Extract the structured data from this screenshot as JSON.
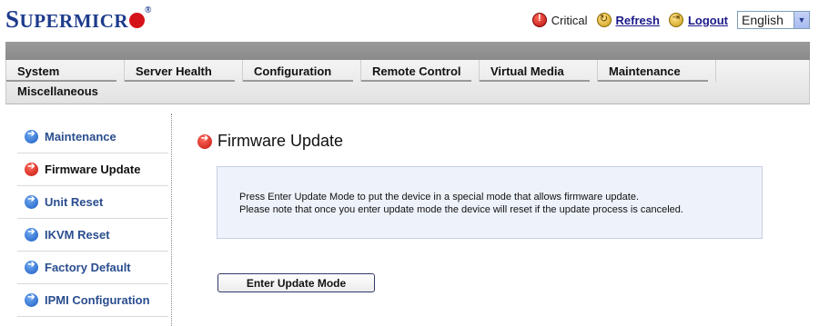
{
  "brand": {
    "name_first": "S",
    "name_rest": "UPERMICR",
    "trademark": "®"
  },
  "header": {
    "critical_label": "Critical",
    "refresh_label": "Refresh",
    "logout_label": "Logout",
    "language": "English"
  },
  "nav": {
    "tabs": [
      "System",
      "Server Health",
      "Configuration",
      "Remote Control",
      "Virtual Media",
      "Maintenance",
      "Miscellaneous"
    ]
  },
  "sidebar": {
    "items": [
      {
        "label": "Maintenance",
        "icon": "blue-arrow-icon"
      },
      {
        "label": "Firmware Update",
        "icon": "red-arrow-icon"
      },
      {
        "label": "Unit Reset",
        "icon": "blue-arrow-icon"
      },
      {
        "label": "IKVM Reset",
        "icon": "blue-arrow-icon"
      },
      {
        "label": "Factory Default",
        "icon": "blue-arrow-icon"
      },
      {
        "label": "IPMI Configuration",
        "icon": "blue-arrow-icon"
      }
    ]
  },
  "main": {
    "title": "Firmware Update",
    "info_line1": "Press Enter Update Mode to put the device in a special mode that allows firmware update.",
    "info_line2": "Please note that once you enter update mode the device will reset if the update process is canceled.",
    "button_label": "Enter Update Mode"
  },
  "colors": {
    "brand_blue": "#1d3b8c",
    "brand_red": "#d4121a",
    "link": "#2a4d8f",
    "info_bg": "#eef3fb"
  }
}
